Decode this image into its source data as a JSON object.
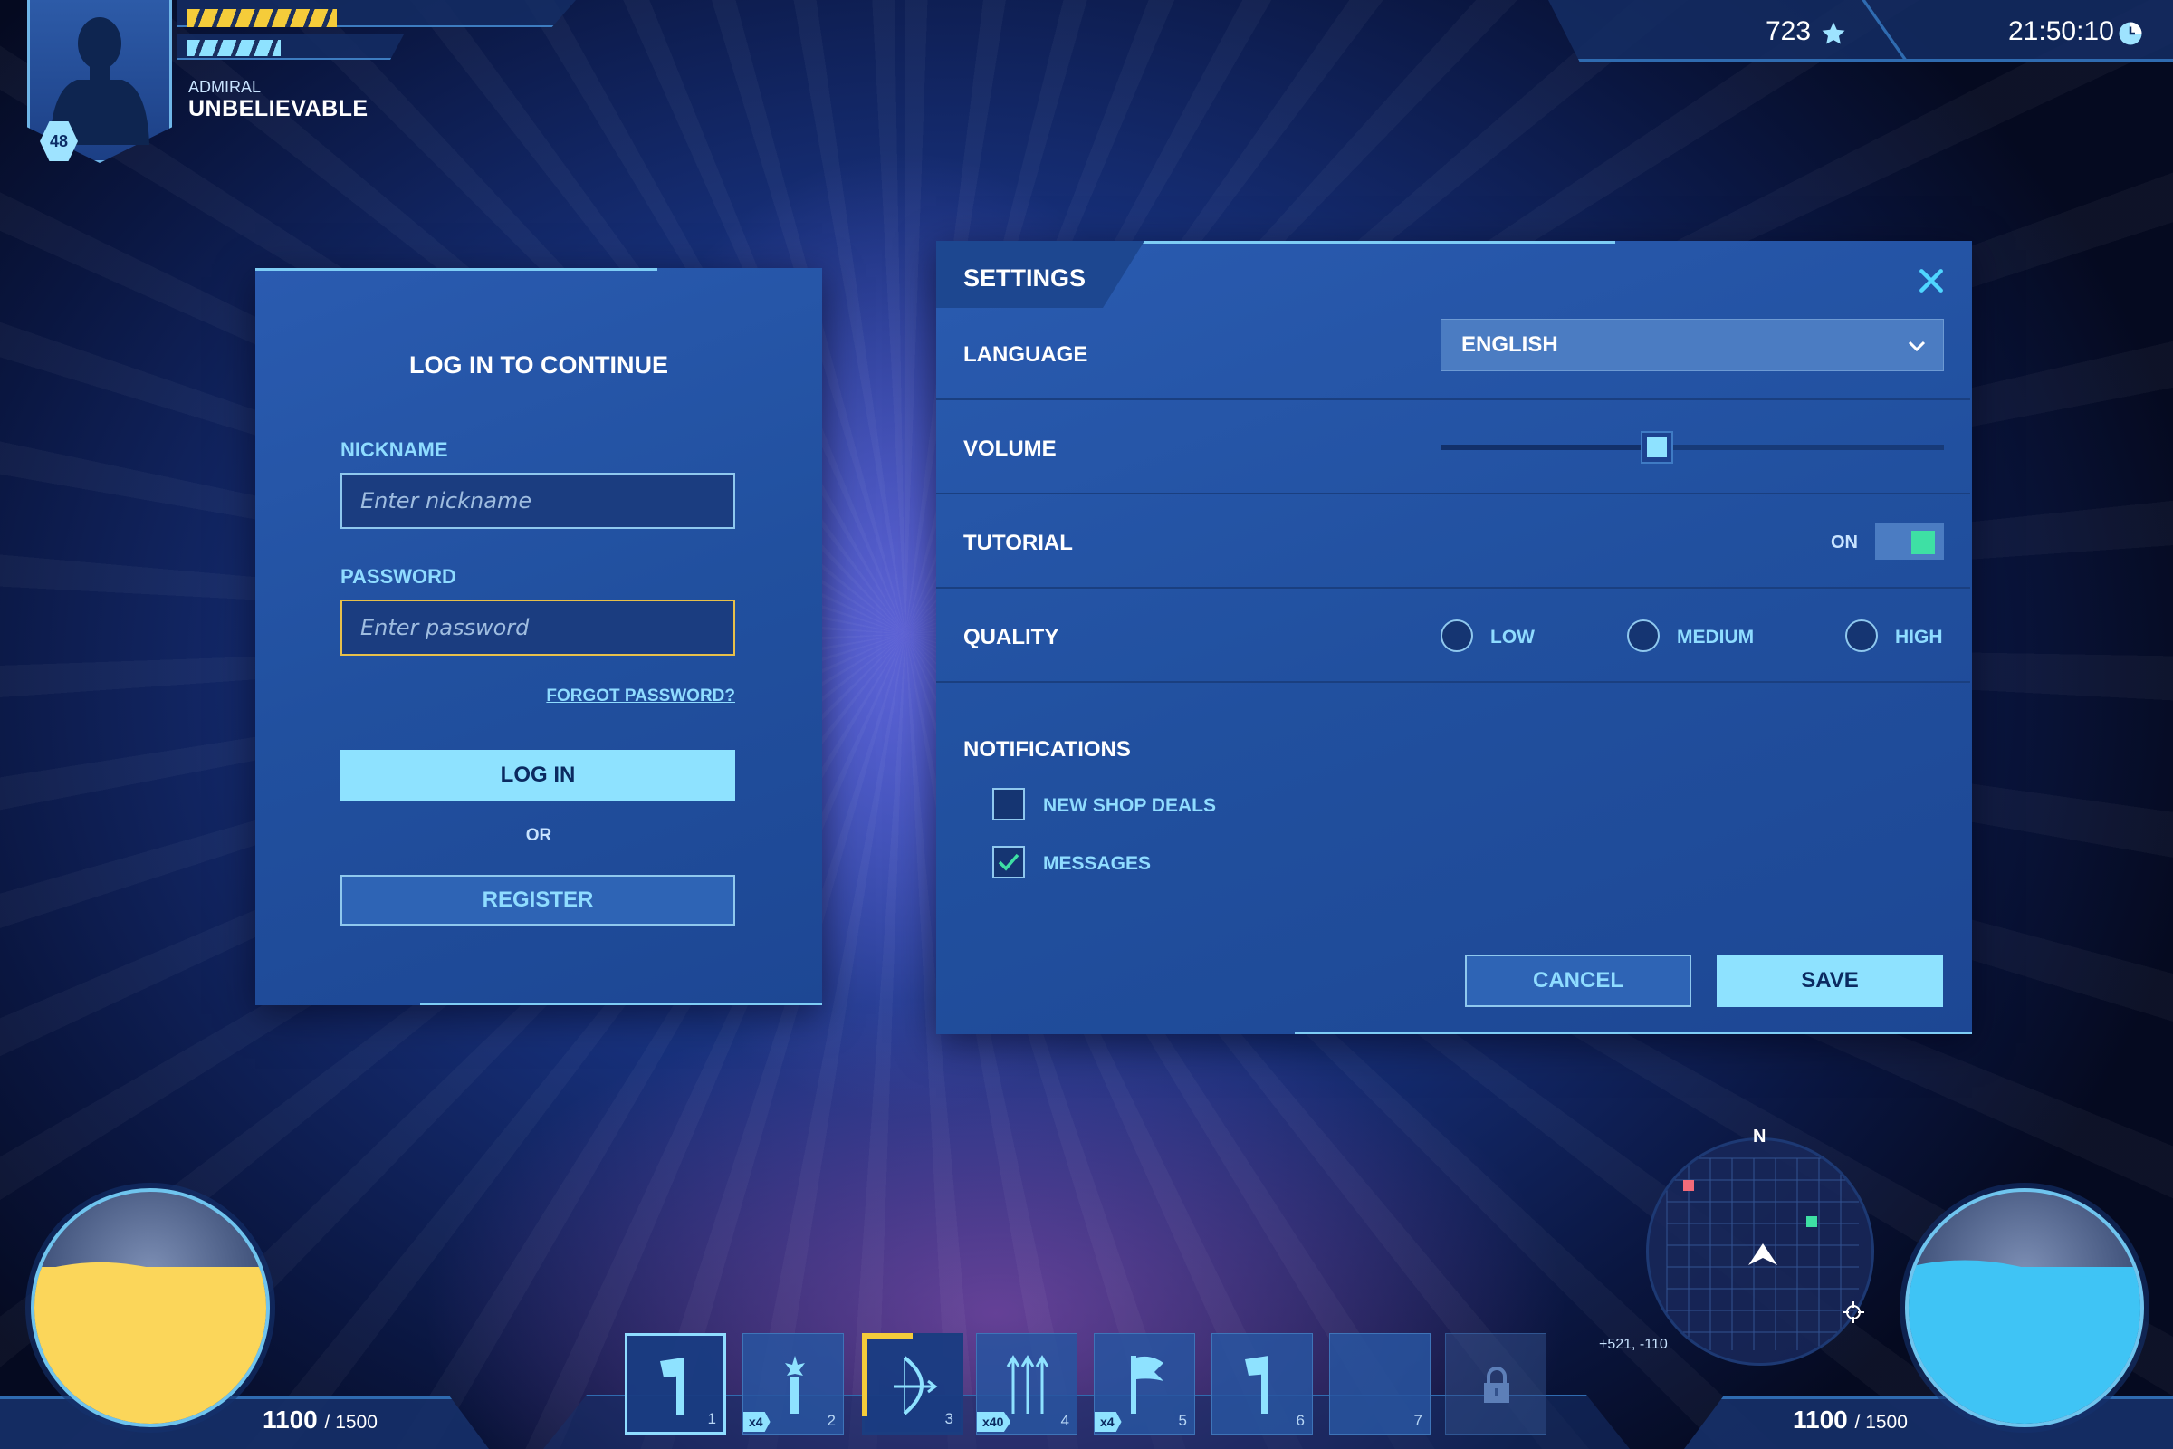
{
  "player": {
    "rank": "ADMIRAL",
    "name": "UNBELIEVABLE",
    "level": "48",
    "xp_progress": 0.6,
    "energy_progress": 0.45,
    "health_bar_color": "#f5cc3a",
    "energy_bar_color": "#8ee2ff"
  },
  "top_right": {
    "stars": "723",
    "time": "21:50:10"
  },
  "login": {
    "title": "LOG IN TO CONTINUE",
    "nickname_label": "NICKNAME",
    "nickname_placeholder": "Enter nickname",
    "password_label": "PASSWORD",
    "password_placeholder": "Enter password",
    "forgot_link": "FORGOT PASSWORD?",
    "login_button": "LOG IN",
    "or_text": "OR",
    "register_button": "REGISTER"
  },
  "settings": {
    "title": "SETTINGS",
    "language_label": "LANGUAGE",
    "language_value": "ENGLISH",
    "volume_label": "VOLUME",
    "volume_value": 0.43,
    "tutorial_label": "TUTORIAL",
    "tutorial_state": "ON",
    "quality_label": "QUALITY",
    "quality_options": [
      "LOW",
      "MEDIUM",
      "HIGH"
    ],
    "notifications_label": "NOTIFICATIONS",
    "notifications": [
      {
        "label": "NEW SHOP DEALS",
        "checked": false
      },
      {
        "label": "MESSAGES",
        "checked": true
      }
    ],
    "cancel_button": "CANCEL",
    "save_button": "SAVE"
  },
  "hud": {
    "health": {
      "current": "1100",
      "max": "/ 1500",
      "fill": 0.73,
      "color": "#fbd65a"
    },
    "mana": {
      "current": "1100",
      "max": "/ 1500",
      "fill": 0.73,
      "color": "#3fc4f5"
    },
    "minimap": {
      "north": "N",
      "coords": "+521, -110"
    },
    "slots": [
      {
        "num": "1",
        "badge": "",
        "icon": "axe-icon"
      },
      {
        "num": "2",
        "badge": "x4",
        "icon": "torch-icon"
      },
      {
        "num": "3",
        "badge": "",
        "icon": "bow-icon"
      },
      {
        "num": "4",
        "badge": "x40",
        "icon": "arrows-icon"
      },
      {
        "num": "5",
        "badge": "x4",
        "icon": "flag-icon"
      },
      {
        "num": "6",
        "badge": "",
        "icon": "axe-icon"
      },
      {
        "num": "7",
        "badge": "",
        "icon": ""
      },
      {
        "num": "",
        "badge": "",
        "icon": "lock-icon"
      }
    ]
  }
}
